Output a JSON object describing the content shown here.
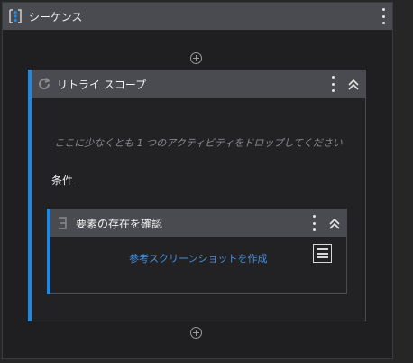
{
  "sequence": {
    "title": "シーケンス"
  },
  "retry_scope": {
    "title": "リトライ スコープ",
    "drop_hint": "ここに少なくとも 1 つのアクティビティをドロップしてください",
    "condition_label": "条件"
  },
  "element_exists": {
    "title": "要素の存在を確認",
    "screenshot_link": "参考スクリーンショットを作成"
  },
  "colors": {
    "accent": "#1e88e5",
    "header": "#4a4b50",
    "link": "#4d8fd6"
  }
}
